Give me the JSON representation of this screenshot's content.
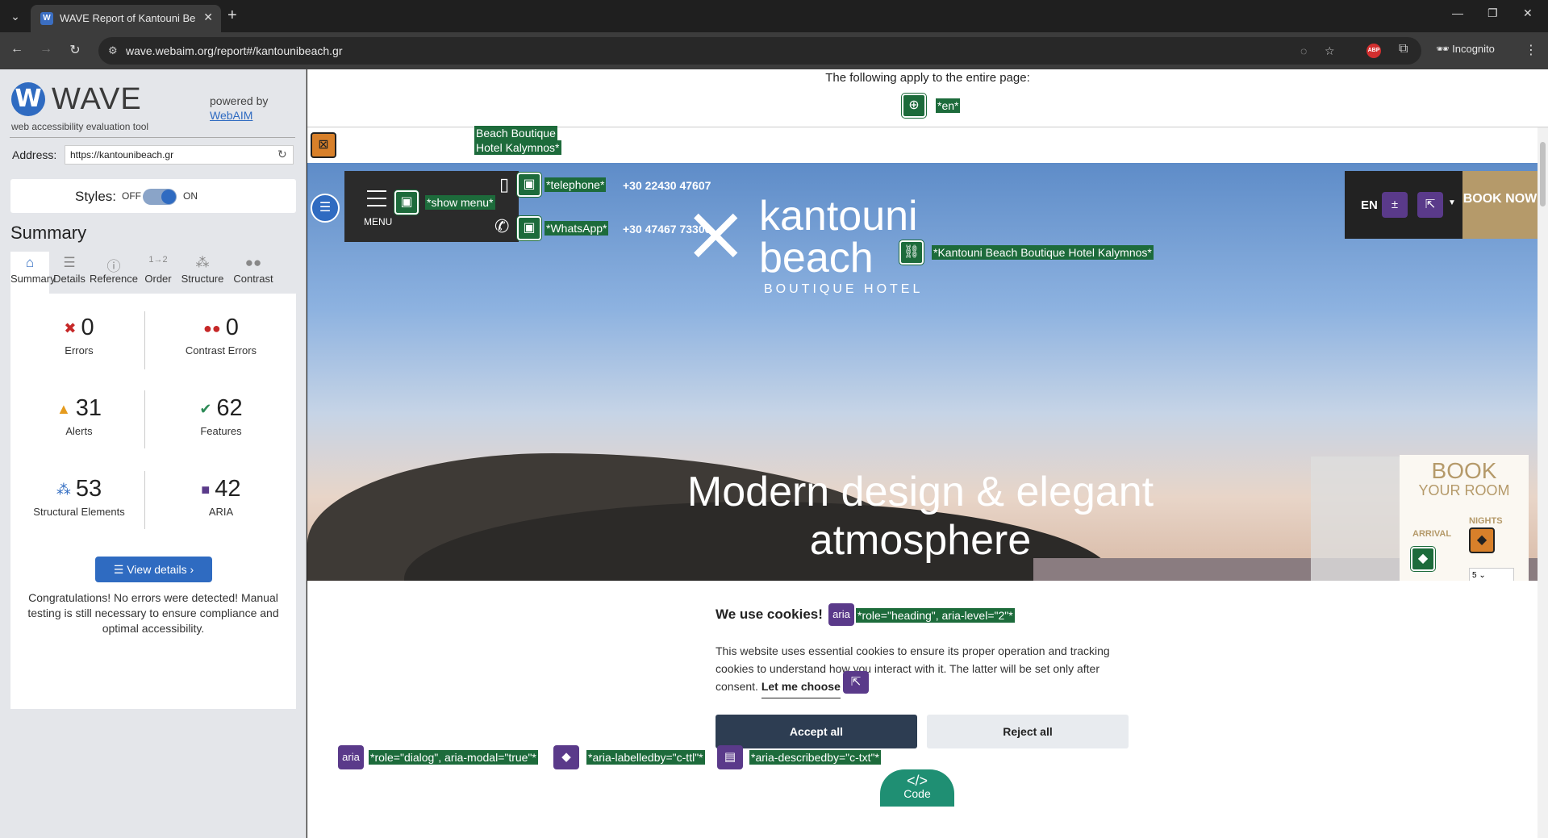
{
  "browser": {
    "tab_title": "WAVE Report of Kantouni Beach",
    "tab_favicon": "W",
    "url": "wave.webaim.org/report#/kantounibeach.gr",
    "incognito_label": "Incognito",
    "abp_label": "ABP"
  },
  "wave": {
    "logo_text": "WAVE",
    "tagline": "web accessibility evaluation tool",
    "powered_by": "powered by",
    "webaim_link": "WebAIM",
    "address_label": "Address:",
    "address_value": "https://kantounibeach.gr",
    "styles_label": "Styles:",
    "styles_off": "OFF",
    "styles_on": "ON",
    "styles_enabled": true,
    "summary_title": "Summary",
    "tabs": [
      {
        "label": "Summary",
        "icon": "home-icon",
        "active": true
      },
      {
        "label": "Details",
        "icon": "list-icon",
        "active": false
      },
      {
        "label": "Reference",
        "icon": "info-icon",
        "active": false
      },
      {
        "label": "Order",
        "icon": "order-icon",
        "active": false
      },
      {
        "label": "Structure",
        "icon": "structure-icon",
        "active": false
      },
      {
        "label": "Contrast",
        "icon": "contrast-icon",
        "active": false
      }
    ],
    "stats": {
      "errors": {
        "value": "0",
        "label": "Errors",
        "color": "#c62828"
      },
      "contrast_errors": {
        "value": "0",
        "label": "Contrast Errors",
        "color": "#c62828"
      },
      "alerts": {
        "value": "31",
        "label": "Alerts",
        "color": "#e59b1e"
      },
      "features": {
        "value": "62",
        "label": "Features",
        "color": "#2e8b57"
      },
      "structural": {
        "value": "53",
        "label": "Structural Elements",
        "color": "#2f6bc1"
      },
      "aria": {
        "value": "42",
        "label": "ARIA",
        "color": "#5a3a8a"
      }
    },
    "view_details": "View details ›",
    "congrats": "Congratulations! No errors were detected! Manual testing is still necessary to ensure compliance and optimal accessibility."
  },
  "page": {
    "entire_page_text": "The following apply to the entire page:",
    "lang_tag": "*en*",
    "hotel_alt_top_1": "Beach Boutique",
    "hotel_alt_top_2": "Hotel Kalymnos*",
    "menu_label": "MENU",
    "show_menu_tag": "*show menu*",
    "telephone_tag": "*telephone*",
    "telephone_number": "+30 22430 47607",
    "whatsapp_tag": "*WhatsApp*",
    "whatsapp_number": "+30 47467 73306",
    "logo_line1": "kantouni",
    "logo_line2": "beach",
    "logo_sub": "BOUTIQUE HOTEL",
    "logo_link_tag": "*Kantouni Beach Boutique Hotel Kalymnos*",
    "lang_code": "EN",
    "book_now": "BOOK NOW",
    "hero_title": "Modern design & elegant atmosphere",
    "book_room_title": "BOOK",
    "book_room_sub": "YOUR ROOM",
    "arrival_label": "ARRIVAL",
    "nights_label": "NIGHTS",
    "nights_value": "5",
    "cookie_title": "We use cookies!",
    "aria_badge": "aria",
    "heading_tag": "*role=\"heading\", aria-level=\"2\"*",
    "cookie_text": "This website uses essential cookies to ensure its proper operation and tracking cookies to understand how you interact with it. The latter will be set only after consent.",
    "let_me_choose": "Let me choose",
    "accept_all": "Accept all",
    "reject_all": "Reject all",
    "dialog_tag": "*role=\"dialog\", aria-modal=\"true\"*",
    "labelledby_tag": "*aria-labelledby=\"c-ttl\"*",
    "describedby_tag": "*aria-describedby=\"c-txt\"*",
    "code_icon": "</>",
    "code_label": "Code"
  }
}
